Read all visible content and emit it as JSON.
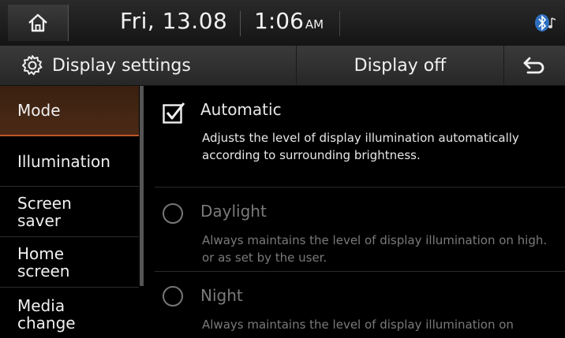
{
  "status": {
    "date": "Fri, 13.08",
    "time": "1:06",
    "ampm": "AM",
    "icons": [
      "home-icon",
      "bluetooth-audio-icon"
    ]
  },
  "titlebar": {
    "title": "Display settings",
    "display_off_label": "Display off",
    "icons": [
      "gear-icon",
      "back-arrow-icon"
    ]
  },
  "sidebar": {
    "items": [
      {
        "label": "Mode"
      },
      {
        "label": "Illumination"
      },
      {
        "label": "Screen\nsaver"
      },
      {
        "label": "Home\nscreen"
      },
      {
        "label": "Media\nchange"
      }
    ]
  },
  "main": {
    "options": [
      {
        "title": "Automatic",
        "desc": "Adjusts the level of display illumination automatically according to surrounding brightness.",
        "control": "checkbox",
        "checked": true,
        "enabled": true
      },
      {
        "title": "Daylight",
        "desc": "Always maintains the level of display illumination on high. or as set by the user.",
        "control": "radio",
        "checked": false,
        "enabled": false
      },
      {
        "title": "Night",
        "desc": "Always maintains the level of display illumination on",
        "control": "radio",
        "checked": false,
        "enabled": false
      }
    ]
  },
  "colors": {
    "accent": "#c0562a",
    "active_bg": "#3a2010",
    "disabled_text": "#7a7a7a"
  }
}
